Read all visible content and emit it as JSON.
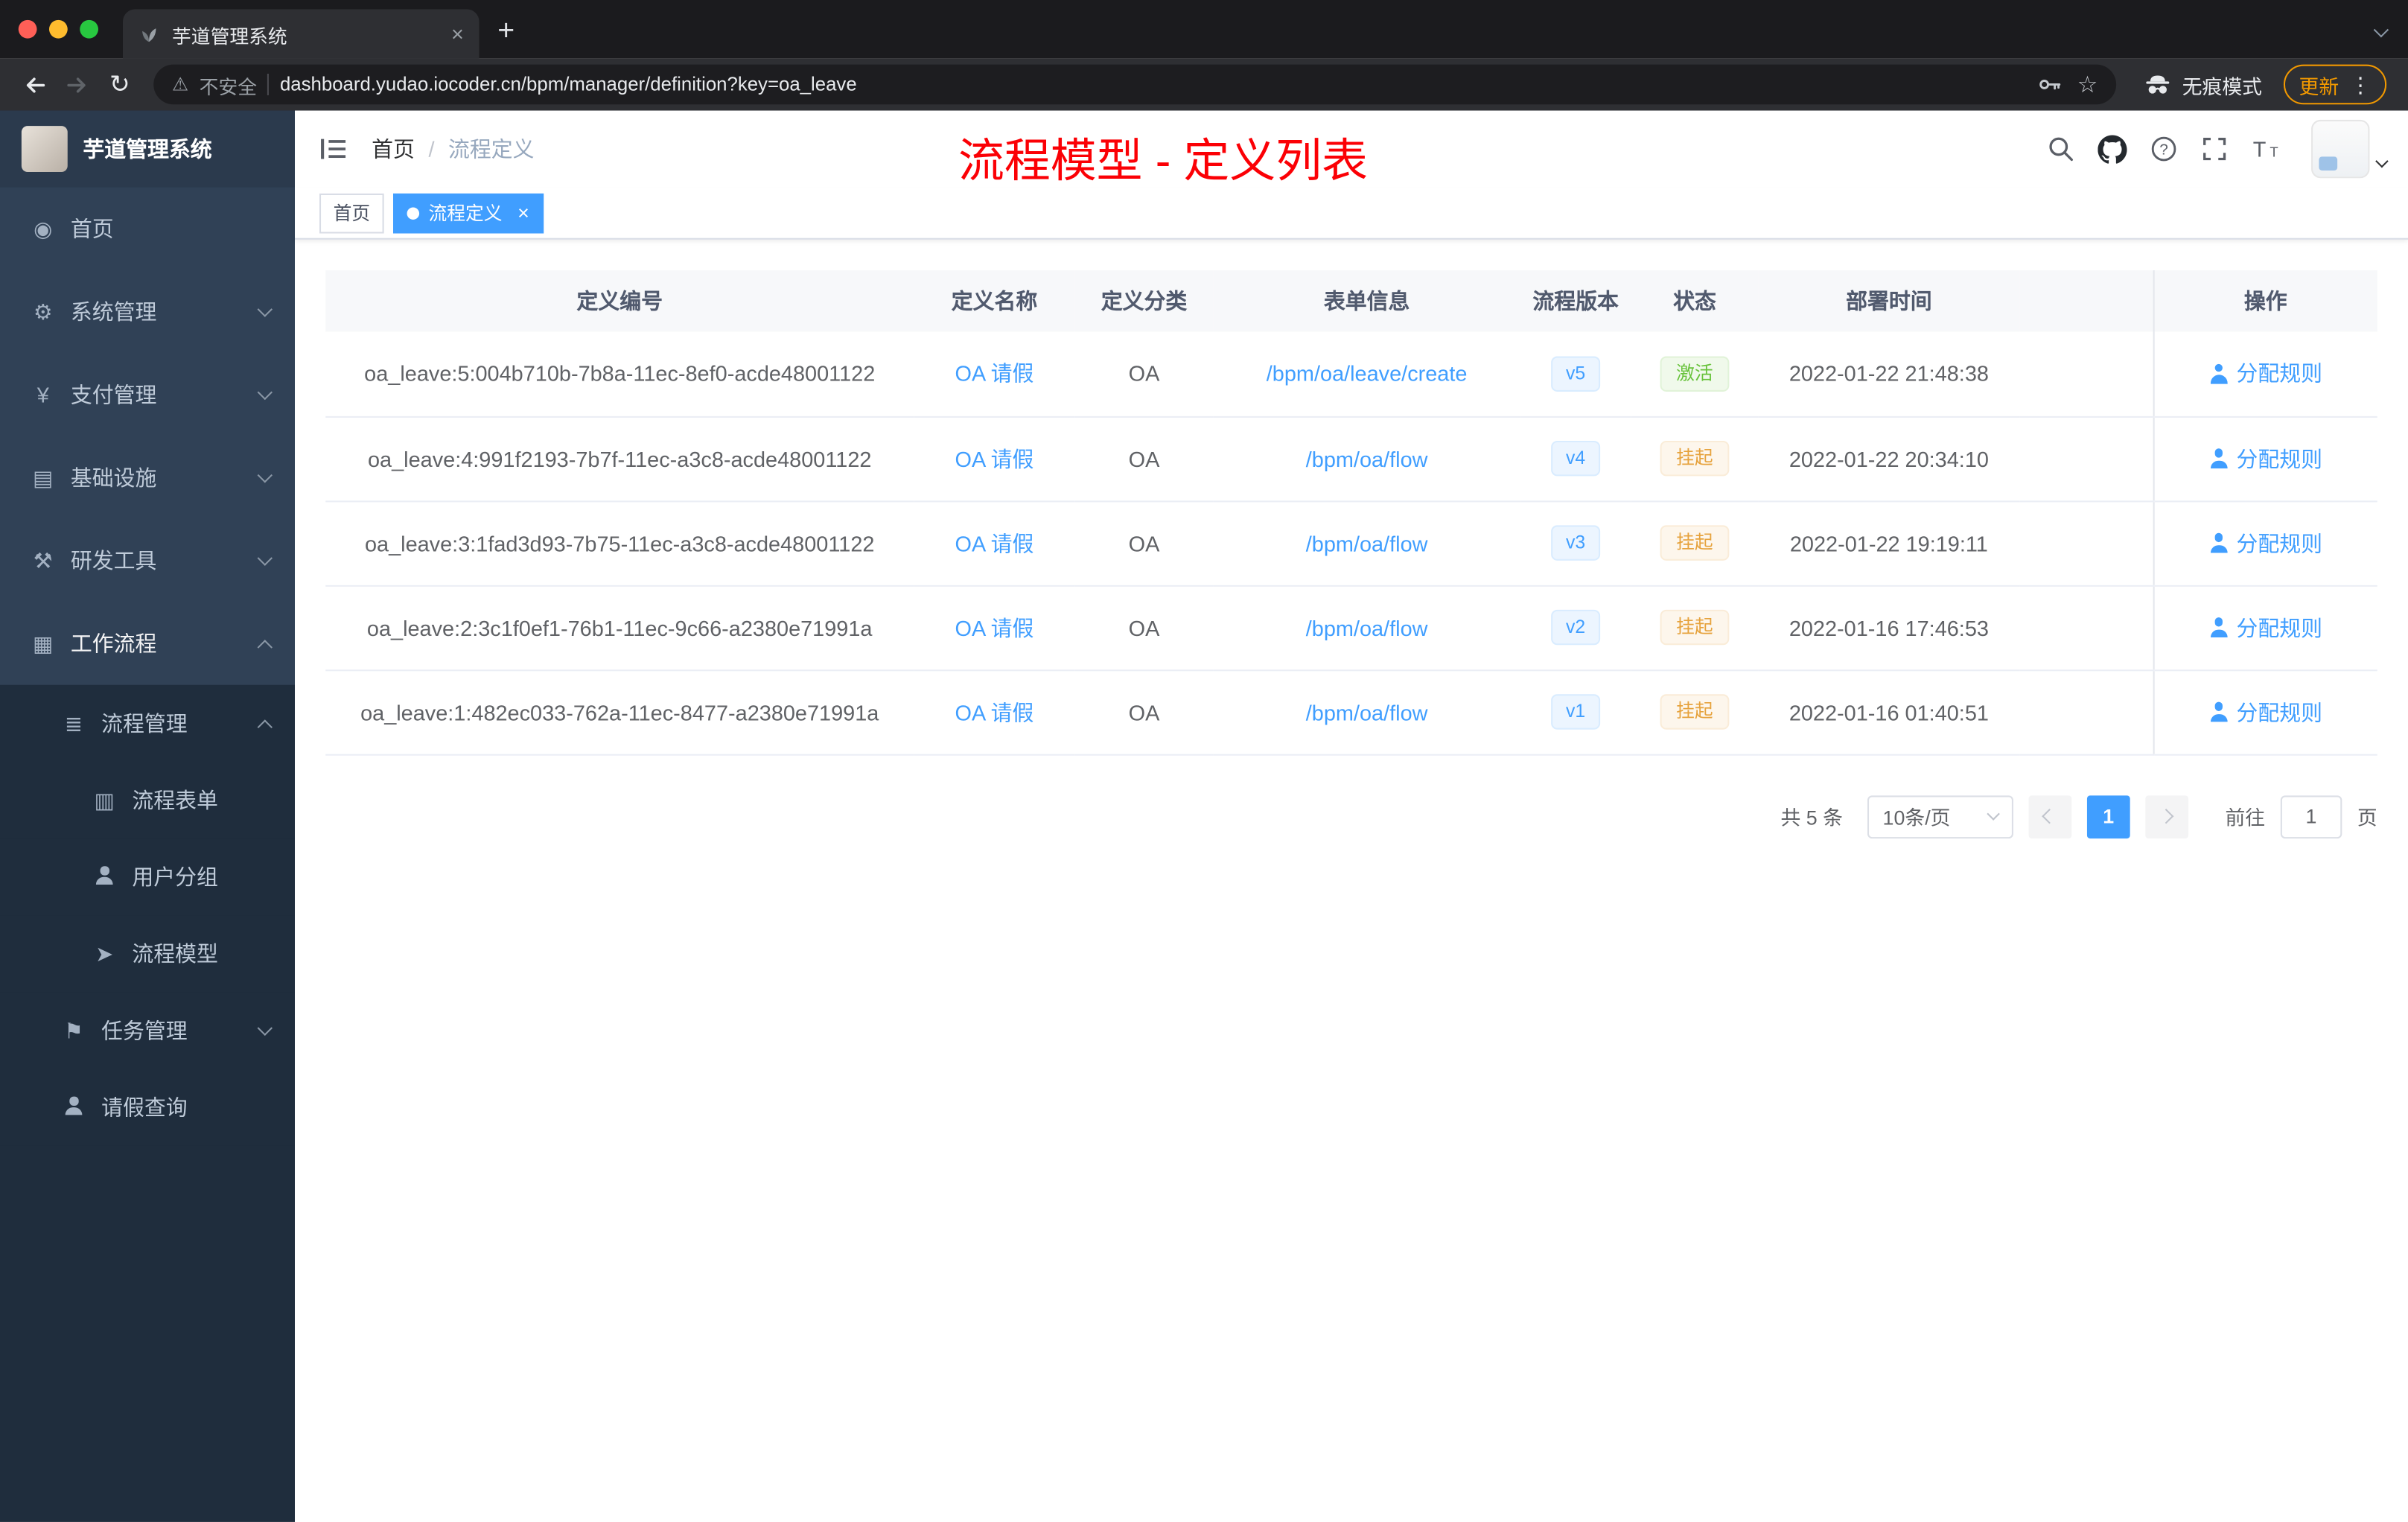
{
  "colors": {
    "accent": "#409eff",
    "success": "#67c23a",
    "warning": "#e6a23c",
    "annotation_red": "#fb0005",
    "sidebar_bg": "#304156",
    "sidebar_sub_bg": "#1f2d3d"
  },
  "icons": {
    "dashboard": "◉",
    "gear": "⚙",
    "yen": "¥",
    "infra": "▤",
    "tools": "⚒",
    "workflow": "▦",
    "list": "≣",
    "form": "▥",
    "plane": "➤",
    "flag": "⚑",
    "reload": "↻",
    "star": "☆",
    "warning": "⚠",
    "dots": "⋮",
    "close": "×",
    "new_tab": "+"
  },
  "browser": {
    "tab_title": "芋道管理系统",
    "security_label": "不安全",
    "url": "dashboard.yudao.iocoder.cn/bpm/manager/definition?key=oa_leave",
    "incognito_label": "无痕模式",
    "update_label": "更新"
  },
  "sidebar": {
    "logo_title": "芋道管理系统",
    "menu": [
      {
        "label": "首页"
      },
      {
        "label": "系统管理"
      },
      {
        "label": "支付管理"
      },
      {
        "label": "基础设施"
      },
      {
        "label": "研发工具"
      },
      {
        "label": "工作流程"
      },
      {
        "label": "流程管理"
      },
      {
        "label": "流程表单"
      },
      {
        "label": "用户分组"
      },
      {
        "label": "流程模型"
      },
      {
        "label": "任务管理"
      },
      {
        "label": "请假查询"
      }
    ]
  },
  "header": {
    "breadcrumb_home": "首页",
    "breadcrumb_sep": "/",
    "breadcrumb_current": "流程定义",
    "annotation": "流程模型 - 定义列表"
  },
  "tags": {
    "home": "首页",
    "active": "流程定义"
  },
  "table": {
    "columns": [
      "定义编号",
      "定义名称",
      "定义分类",
      "表单信息",
      "流程版本",
      "状态",
      "部署时间",
      "操作"
    ],
    "rows": [
      {
        "id": "oa_leave:5:004b710b-7b8a-11ec-8ef0-acde48001122",
        "name": "OA 请假",
        "category": "OA",
        "form": "/bpm/oa/leave/create",
        "version": "v5",
        "status": "激活",
        "time": "2022-01-22 21:48:38",
        "action": "分配规则"
      },
      {
        "id": "oa_leave:4:991f2193-7b7f-11ec-a3c8-acde48001122",
        "name": "OA 请假",
        "category": "OA",
        "form": "/bpm/oa/flow",
        "version": "v4",
        "status": "挂起",
        "time": "2022-01-22 20:34:10",
        "action": "分配规则"
      },
      {
        "id": "oa_leave:3:1fad3d93-7b75-11ec-a3c8-acde48001122",
        "name": "OA 请假",
        "category": "OA",
        "form": "/bpm/oa/flow",
        "version": "v3",
        "status": "挂起",
        "time": "2022-01-22 19:19:11",
        "action": "分配规则"
      },
      {
        "id": "oa_leave:2:3c1f0ef1-76b1-11ec-9c66-a2380e71991a",
        "name": "OA 请假",
        "category": "OA",
        "form": "/bpm/oa/flow",
        "version": "v2",
        "status": "挂起",
        "time": "2022-01-16 17:46:53",
        "action": "分配规则"
      },
      {
        "id": "oa_leave:1:482ec033-762a-11ec-8477-a2380e71991a",
        "name": "OA 请假",
        "category": "OA",
        "form": "/bpm/oa/flow",
        "version": "v1",
        "status": "挂起",
        "time": "2022-01-16 01:40:51",
        "action": "分配规则"
      }
    ]
  },
  "pagination": {
    "total": "共 5 条",
    "page_size": "10条/页",
    "page": "1",
    "goto_label": "前往",
    "goto_value": "1",
    "page_unit": "页"
  }
}
